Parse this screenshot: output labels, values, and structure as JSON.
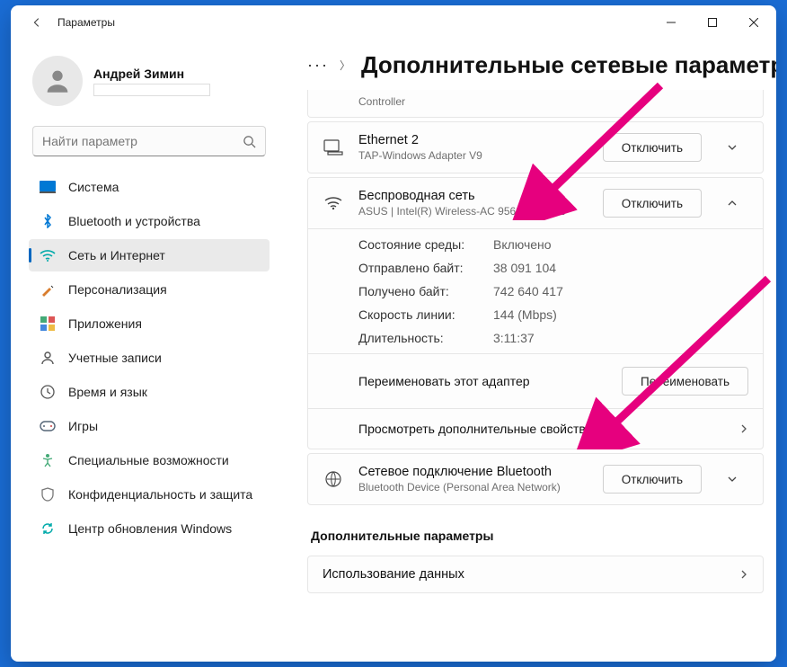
{
  "window": {
    "title": "Параметры"
  },
  "profile": {
    "name": "Андрей Зимин"
  },
  "search": {
    "placeholder": "Найти параметр"
  },
  "nav": {
    "items": [
      {
        "label": "Система",
        "icon": "system"
      },
      {
        "label": "Bluetooth и устройства",
        "icon": "bluetooth"
      },
      {
        "label": "Сеть и Интернет",
        "icon": "network",
        "active": true
      },
      {
        "label": "Персонализация",
        "icon": "personalization"
      },
      {
        "label": "Приложения",
        "icon": "apps"
      },
      {
        "label": "Учетные записи",
        "icon": "accounts"
      },
      {
        "label": "Время и язык",
        "icon": "time"
      },
      {
        "label": "Игры",
        "icon": "gaming"
      },
      {
        "label": "Специальные возможности",
        "icon": "accessibility"
      },
      {
        "label": "Конфиденциальность и защита",
        "icon": "privacy"
      },
      {
        "label": "Центр обновления Windows",
        "icon": "update"
      }
    ]
  },
  "breadcrumb": {
    "more": "···",
    "title": "Дополнительные сетевые параметры"
  },
  "adapters": {
    "ethernet2": {
      "title": "Ethernet 2",
      "subtitle": "TAP-Windows Adapter V9",
      "action": "Отключить"
    },
    "wifi": {
      "title": "Беспроводная сеть",
      "subtitle": "ASUS | Intel(R) Wireless-AC 9560 160MHz",
      "action": "Отключить",
      "details": {
        "status_l": "Состояние среды:",
        "status_v": "Включено",
        "sent_l": "Отправлено байт:",
        "sent_v": "38 091 104",
        "recv_l": "Получено байт:",
        "recv_v": "742 640 417",
        "speed_l": "Скорость линии:",
        "speed_v": "144 (Mbps)",
        "dur_l": "Длительность:",
        "dur_v": "3:11:37"
      },
      "rename_l": "Переименовать этот адаптер",
      "rename_btn": "Переименовать",
      "more_props": "Просмотреть дополнительные свойства"
    },
    "bt": {
      "title": "Сетевое подключение Bluetooth",
      "subtitle": "Bluetooth Device (Personal Area Network)",
      "action": "Отключить"
    }
  },
  "extra": {
    "heading": "Дополнительные параметры",
    "data_usage": "Использование данных"
  },
  "colors": {
    "arrow": "#e6007e"
  }
}
